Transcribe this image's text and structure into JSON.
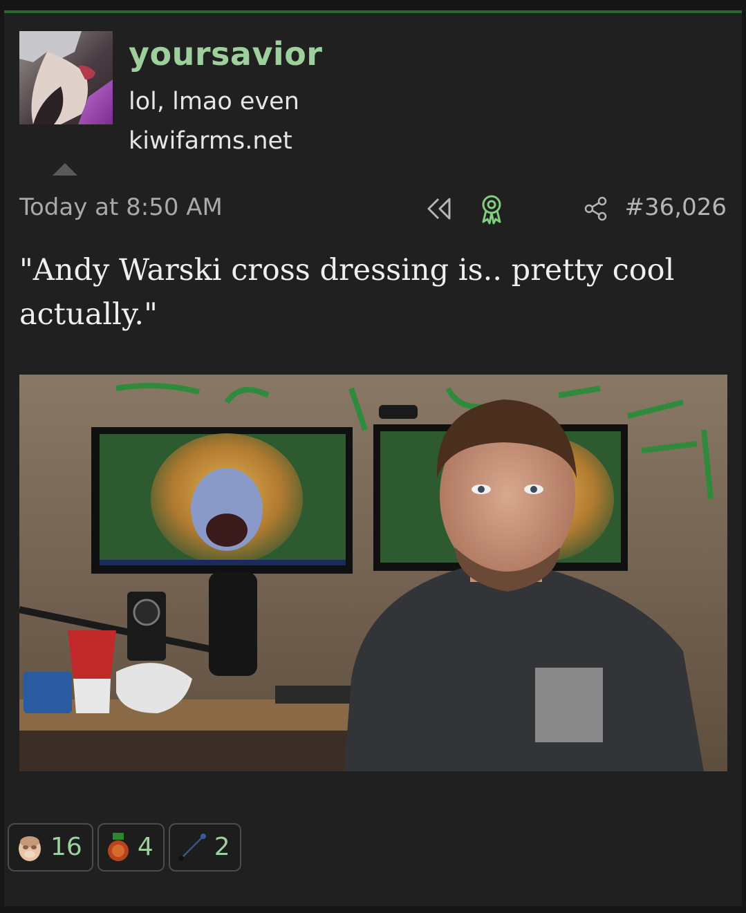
{
  "post": {
    "username": "yoursavior",
    "user_title": "lol, lmao even",
    "user_site": "kiwifarms.net",
    "timestamp": "Today at 8:50 AM",
    "post_number": "#36,026",
    "body": "\"Andy Warski cross dressing is.. pretty cool actually.\"",
    "icons": [
      "rewind-icon",
      "award-ribbon-icon",
      "share-icon"
    ]
  },
  "reactions": [
    {
      "icon": "face-reaction-icon",
      "count": "16"
    },
    {
      "icon": "medal-reaction-icon",
      "count": "4"
    },
    {
      "icon": "line-reaction-icon",
      "count": "2"
    }
  ],
  "colors": {
    "username": "#9ed09e",
    "accent_border": "#2c6a2c",
    "background": "#202020",
    "count": "#9ed09e"
  }
}
